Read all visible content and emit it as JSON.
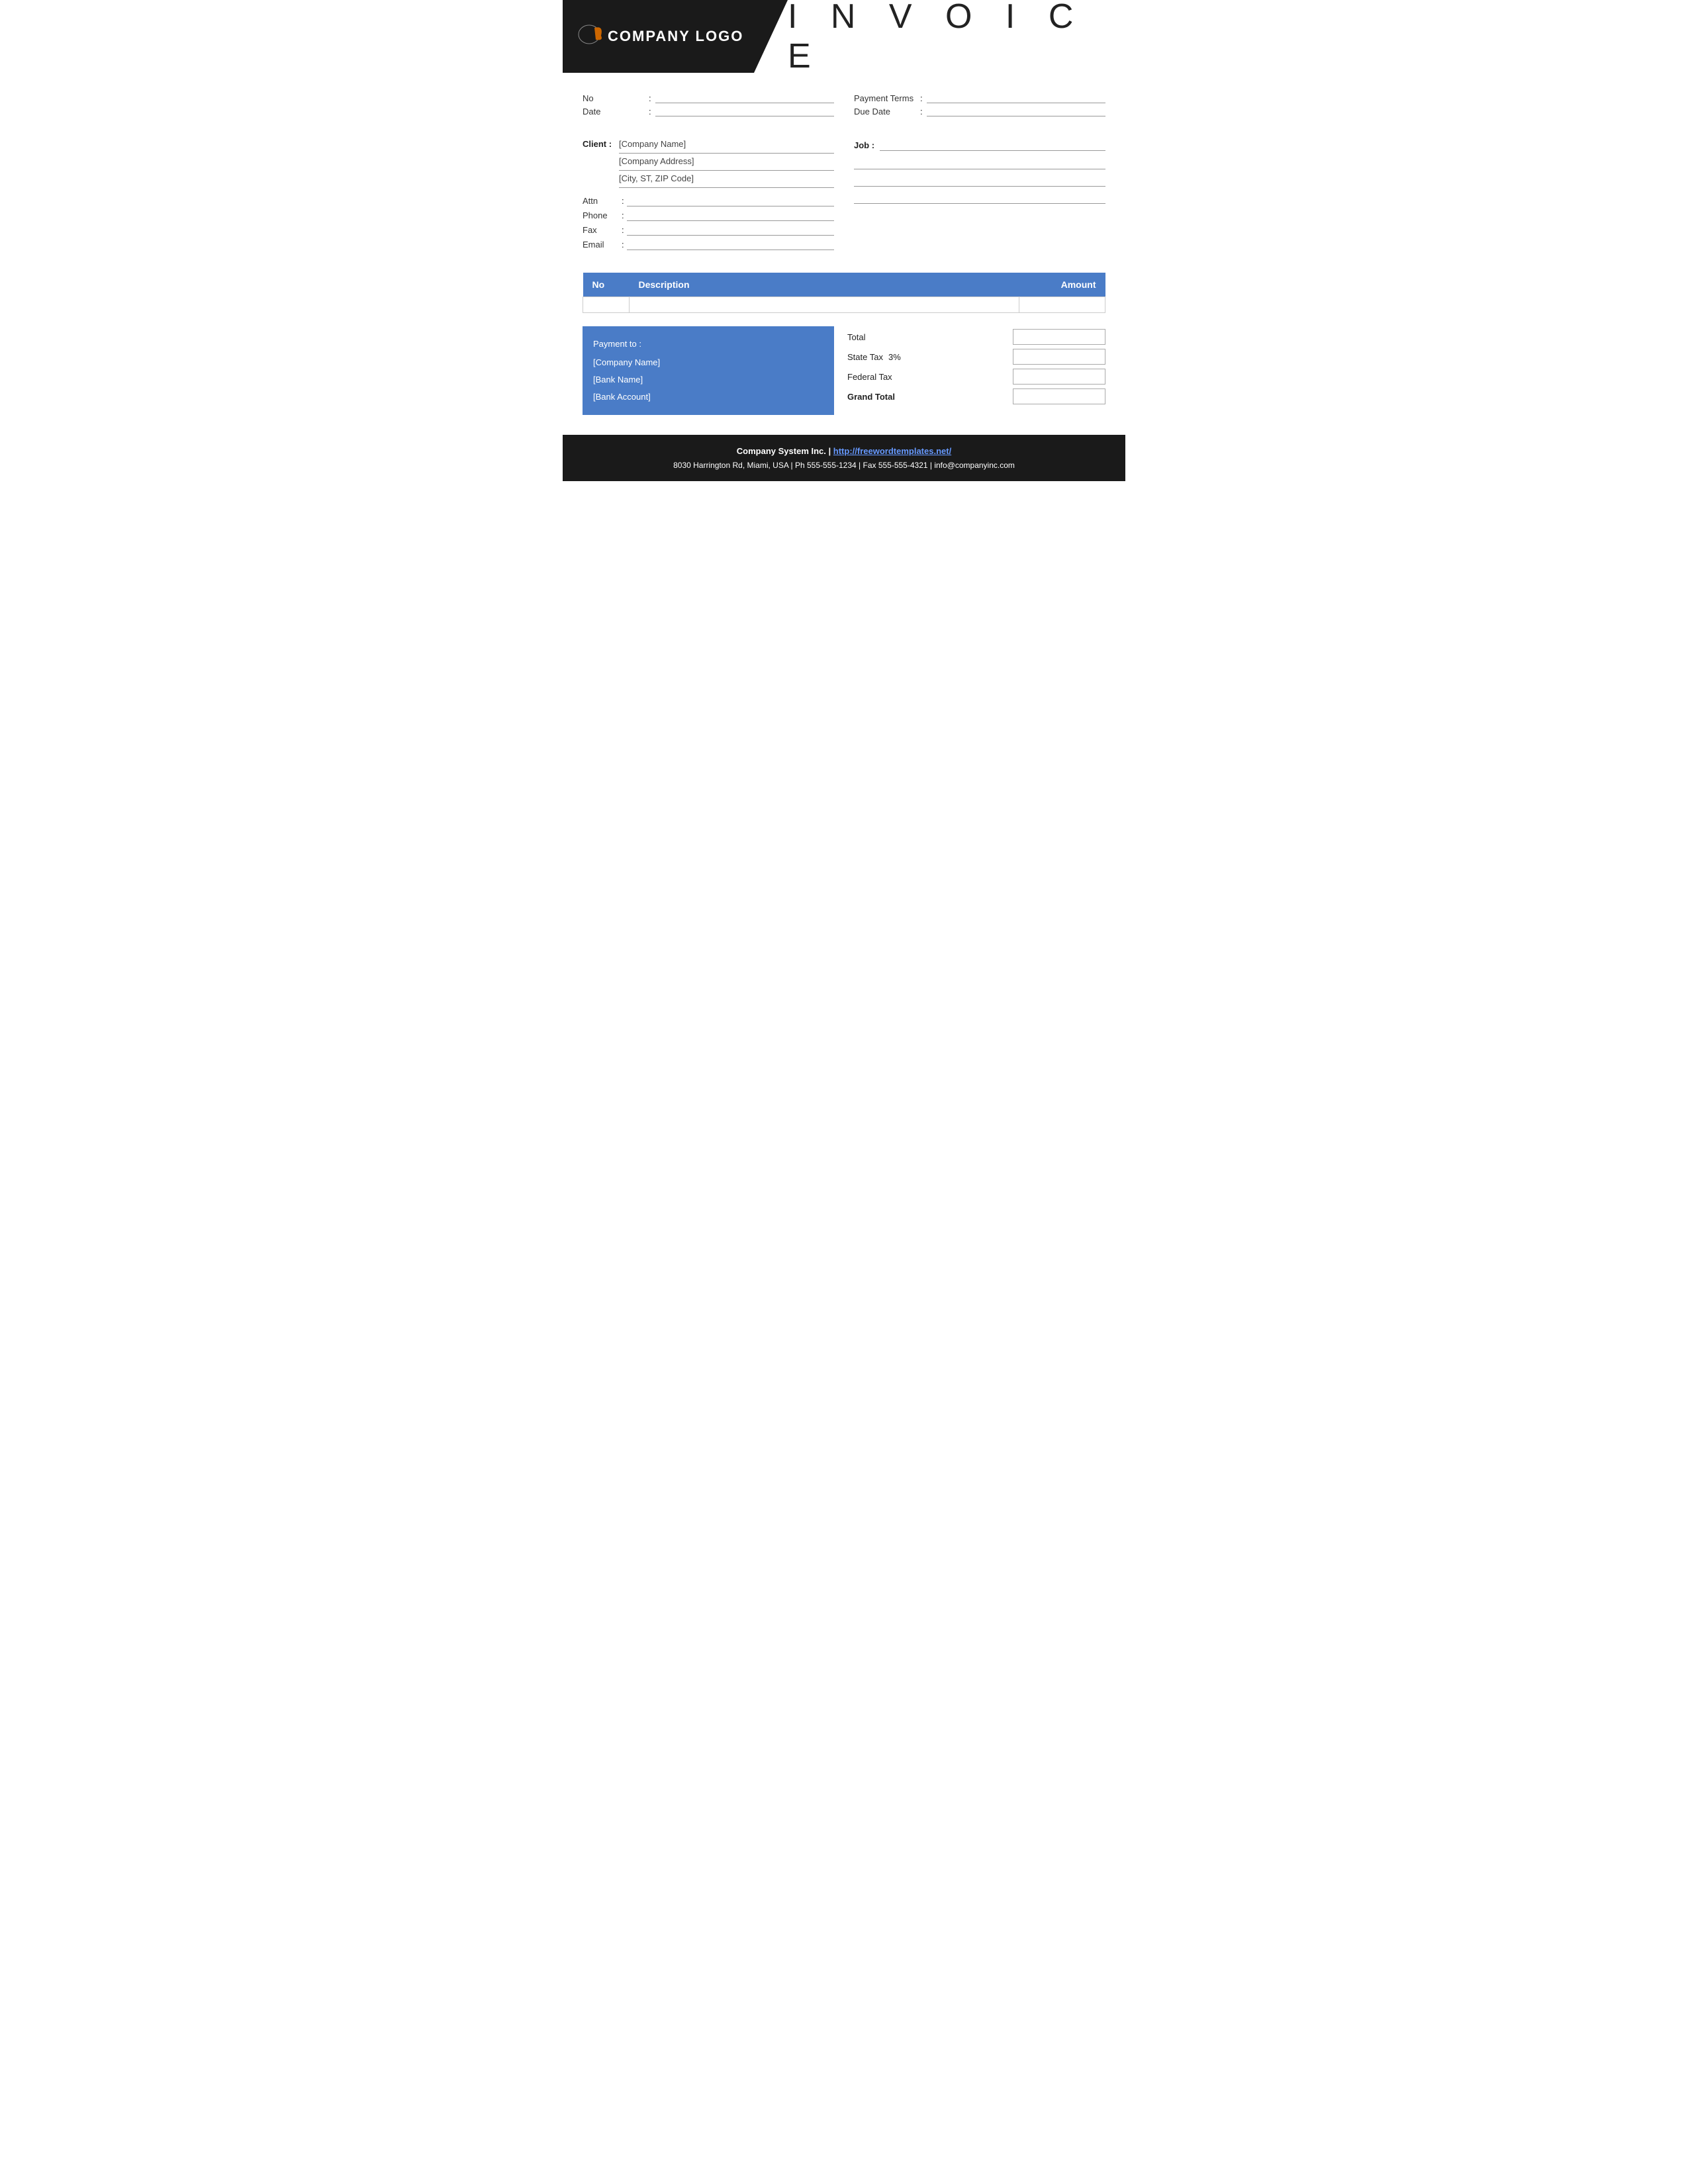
{
  "header": {
    "logo_text": "COMPANY LOGO",
    "invoice_title": "I N V O I C E"
  },
  "meta": {
    "no_label": "No",
    "no_colon": ":",
    "payment_terms_label": "Payment  Terms",
    "payment_terms_colon": ":",
    "date_label": "Date",
    "date_colon": ":",
    "due_date_label": "Due Date",
    "due_date_colon": ":"
  },
  "client": {
    "label": "Client :",
    "company_name": "[Company Name]",
    "company_address": "[Company Address]",
    "city_zip": "[City, ST, ZIP Code]",
    "attn_label": "Attn",
    "phone_label": "Phone",
    "fax_label": "Fax",
    "email_label": "Email"
  },
  "job": {
    "label": "Job :"
  },
  "table": {
    "col_no": "No",
    "col_description": "Description",
    "col_amount": "Amount"
  },
  "payment": {
    "title": "Payment to :",
    "company_name": "[Company Name]",
    "bank_name": "[Bank Name]",
    "bank_account": "[Bank Account]"
  },
  "totals": {
    "total_label": "Total",
    "state_tax_label": "State Tax",
    "state_tax_percent": "3%",
    "federal_tax_label": "Federal Tax",
    "grand_total_label": "Grand Total"
  },
  "footer": {
    "line1_company": "Company System Inc.",
    "line1_separator": " | ",
    "line1_url": "http://freewordtemplates.net/",
    "line2": "8030 Harrington Rd, Miami, USA | Ph 555-555-1234 | Fax 555-555-4321 | info@companyinc.com"
  }
}
